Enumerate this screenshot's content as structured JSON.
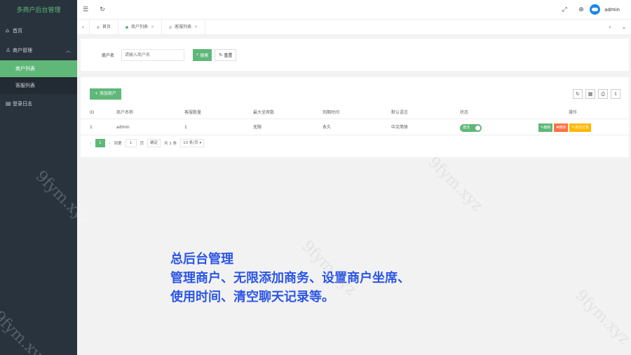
{
  "app": {
    "title": "多商户后台管理"
  },
  "sidebar": {
    "items": [
      {
        "label": "首页",
        "icon": "home-icon"
      },
      {
        "label": "商户管理",
        "icon": "user-icon",
        "expanded": true,
        "children": [
          {
            "label": "商户列表",
            "active": true
          },
          {
            "label": "客服列表"
          }
        ]
      },
      {
        "label": "登录日志",
        "icon": "log-icon"
      }
    ]
  },
  "header": {
    "username": "admin"
  },
  "tabs": [
    {
      "label": "首页",
      "active": false
    },
    {
      "label": "商户列表",
      "active": true
    },
    {
      "label": "客服列表",
      "active": false
    }
  ],
  "search": {
    "label": "商户名",
    "placeholder": "请输入商户名",
    "search_btn": "搜索",
    "reset_btn": "重置"
  },
  "table": {
    "add_btn": "+ 添加商户",
    "columns": [
      "ID",
      "商户名称",
      "客服数量",
      "最大坐席数",
      "到期时间",
      "默认语言",
      "状态",
      "操作"
    ],
    "rows": [
      {
        "id": "1",
        "name": "admin",
        "agents": "1",
        "max_seats": "无限",
        "expire": "永久",
        "lang": "中文简体",
        "status": "激活",
        "ops": [
          "✎编辑",
          "✖删除",
          "✎清空记录"
        ]
      }
    ]
  },
  "pager": {
    "current": "1",
    "goto_label": "到第",
    "goto_value": "1",
    "page_unit": "页",
    "confirm": "确定",
    "total": "共 1 条",
    "per_page": "10 条/页 ▾"
  },
  "overlay": {
    "line1": "总后台管理",
    "line2": "管理商户、无限添加商务、设置商户坐席、",
    "line3": "使用时间、清空聊天记录等。"
  },
  "watermark": "9fym.xyz"
}
